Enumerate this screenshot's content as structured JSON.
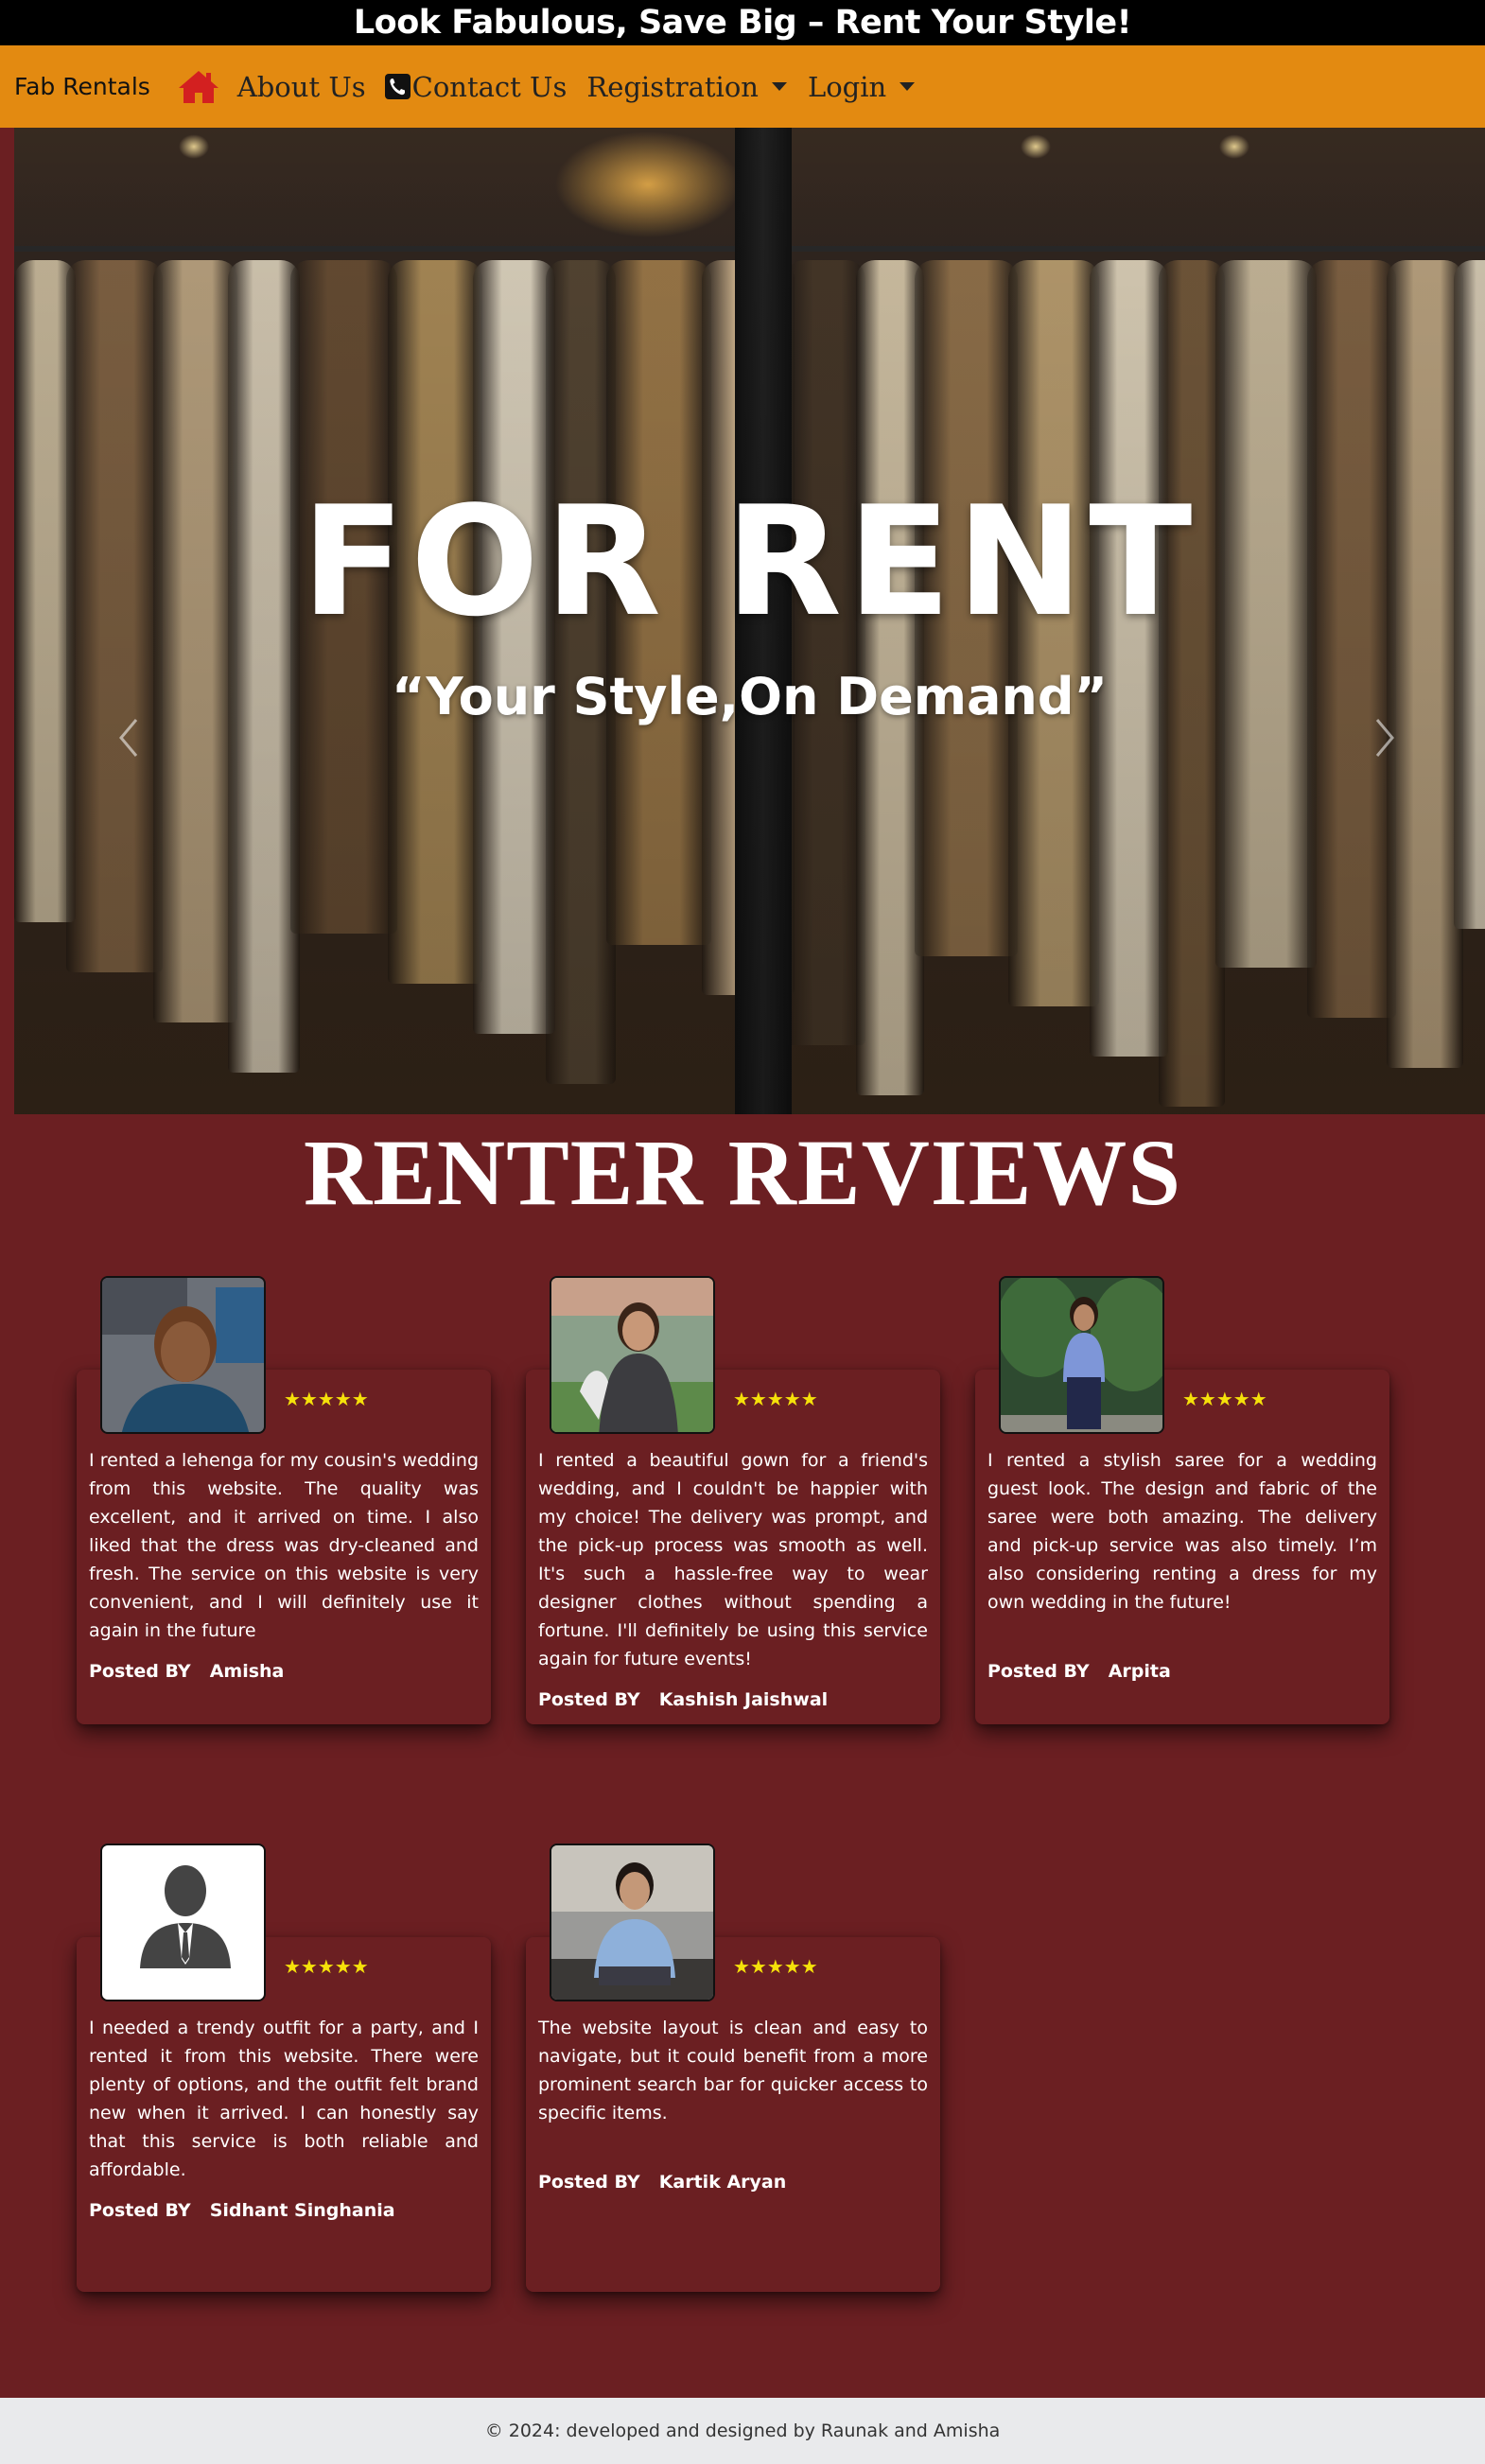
{
  "banner": {
    "text": "Look Fabulous, Save Big – Rent Your Style!"
  },
  "nav": {
    "brand": "Fab Rentals",
    "home_icon": "home-icon",
    "about": "About Us",
    "contact_icon": "phone-icon",
    "contact": "Contact Us",
    "registration": "Registration",
    "login": "Login"
  },
  "hero": {
    "title": "FOR RENT",
    "subtitle": "“Your Style,On Demand”",
    "prev_icon": "chevron-left-icon",
    "next_icon": "chevron-right-icon"
  },
  "reviews": {
    "title": "RENTER REVIEWS",
    "posted_label": "Posted BY",
    "items": [
      {
        "stars": "★★★★★",
        "text": "I rented a lehenga for my cousin's wedding from this website. The quality was excellent, and it arrived on time. I also liked that the dress was dry-cleaned and fresh. The service on this website is very convenient, and I will definitely use it again in the future",
        "author": "Amisha"
      },
      {
        "stars": "★★★★★",
        "text": "I rented a beautiful gown for a friend's wedding, and I couldn't be happier with my choice! The delivery was prompt, and the pick-up process was smooth as well. It's such a hassle-free way to wear designer clothes without spending a fortune. I'll definitely be using this service again for future events!",
        "author": "Kashish Jaishwal"
      },
      {
        "stars": "★★★★★",
        "text": "I rented a stylish saree for a wedding guest look. The design and fabric of the saree were both amazing. The delivery and pick-up service was also timely. I’m also considering renting a dress for my own wedding in the future!",
        "author": "Arpita"
      },
      {
        "stars": "★★★★★",
        "text": "I needed a trendy outfit for a party, and I rented it from this website. There were plenty of options, and the outfit felt brand new when it arrived. I can honestly say that this service is both reliable and affordable.",
        "author": "Sidhant Singhania"
      },
      {
        "stars": "★★★★★",
        "text": "The website layout is clean and easy to navigate, but it could benefit from a more prominent search bar for quicker access to specific items.",
        "author": "Kartik Aryan"
      }
    ]
  },
  "footer": {
    "text": "© 2024: developed and designed by Raunak and Amisha"
  },
  "colors": {
    "banner": "#000000",
    "navbar": "#e38a11",
    "page": "#6b1f22",
    "stars": "#f5e10a",
    "home_icon": "#d32020",
    "footer": "#e9eaec"
  }
}
